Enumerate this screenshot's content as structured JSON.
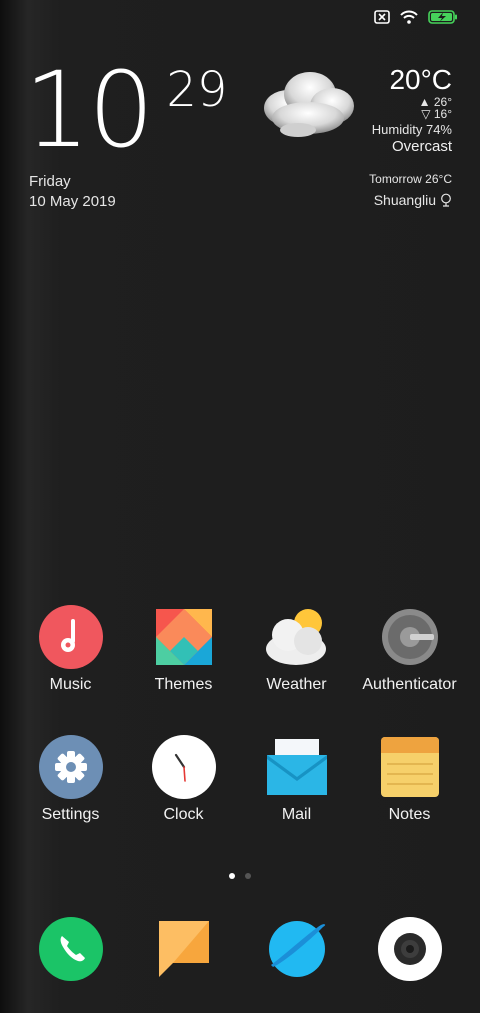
{
  "clock": {
    "hour": "10",
    "minute": "29",
    "day": "Friday",
    "date": "10 May 2019"
  },
  "weather": {
    "temperature": "20°C",
    "high": "26°",
    "low": "16°",
    "humidity": "Humidity 74%",
    "condition": "Overcast",
    "tomorrow": "Tomorrow 26°C",
    "location": "Shuangliu"
  },
  "apps": [
    {
      "label": "Music"
    },
    {
      "label": "Themes"
    },
    {
      "label": "Weather"
    },
    {
      "label": "Authenticator"
    },
    {
      "label": "Settings"
    },
    {
      "label": "Clock"
    },
    {
      "label": "Mail"
    },
    {
      "label": "Notes"
    }
  ],
  "colors": {
    "music": "#f0575e",
    "settings": "#6d8fb5",
    "phone": "#1bc467",
    "message": "#fdbe63",
    "browser": "#21b9f2",
    "mail": "#2bb6e6",
    "notes": "#f6d06a"
  }
}
